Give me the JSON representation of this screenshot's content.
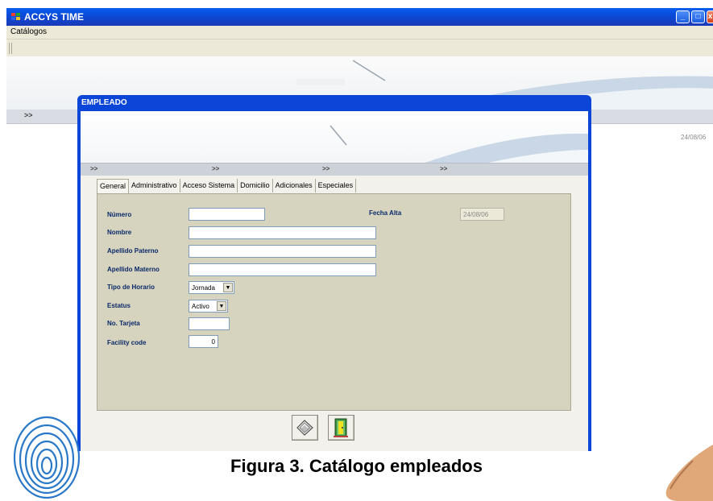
{
  "app": {
    "title": "ACCYS TIME",
    "menu": {
      "catalogos": "Catálogos"
    },
    "background_arrows": ">>",
    "background_date": "24/08/06",
    "window_controls": {
      "minimize": "_",
      "maximize": "□",
      "close": "x"
    }
  },
  "dialog": {
    "title": "EMPLEADO",
    "strip_arrows": [
      ">>",
      ">>",
      ">>",
      ">>"
    ],
    "tabs": [
      {
        "label": "General",
        "active": true
      },
      {
        "label": "Administrativo",
        "active": false
      },
      {
        "label": "Acceso Sistema",
        "active": false
      },
      {
        "label": "Domicilio",
        "active": false
      },
      {
        "label": "Adicionales",
        "active": false
      },
      {
        "label": "Especiales",
        "active": false
      }
    ],
    "form": {
      "numero": {
        "label": "Número",
        "value": ""
      },
      "fecha_alta": {
        "label": "Fecha Alta",
        "value": "24/08/06"
      },
      "nombre": {
        "label": "Nombre",
        "value": ""
      },
      "apellido_paterno": {
        "label": "Apellido Paterno",
        "value": ""
      },
      "apellido_materno": {
        "label": "Apellido Materno",
        "value": ""
      },
      "tipo_horario": {
        "label": "Tipo de Horario",
        "value": "Jornada"
      },
      "estatus": {
        "label": "Estatus",
        "value": "Activo"
      },
      "no_tarjeta": {
        "label": "No. Tarjeta",
        "value": ""
      },
      "facility_code": {
        "label": "Facility code",
        "value": "0"
      }
    },
    "buttons": {
      "save_icon": "save-disk-icon",
      "exit_icon": "exit-door-icon"
    }
  },
  "caption": "Figura 3. Catálogo empleados",
  "colors": {
    "title_bar": "#0a4ad8",
    "panel": "#d6d3be",
    "label": "#0a2a6a"
  }
}
